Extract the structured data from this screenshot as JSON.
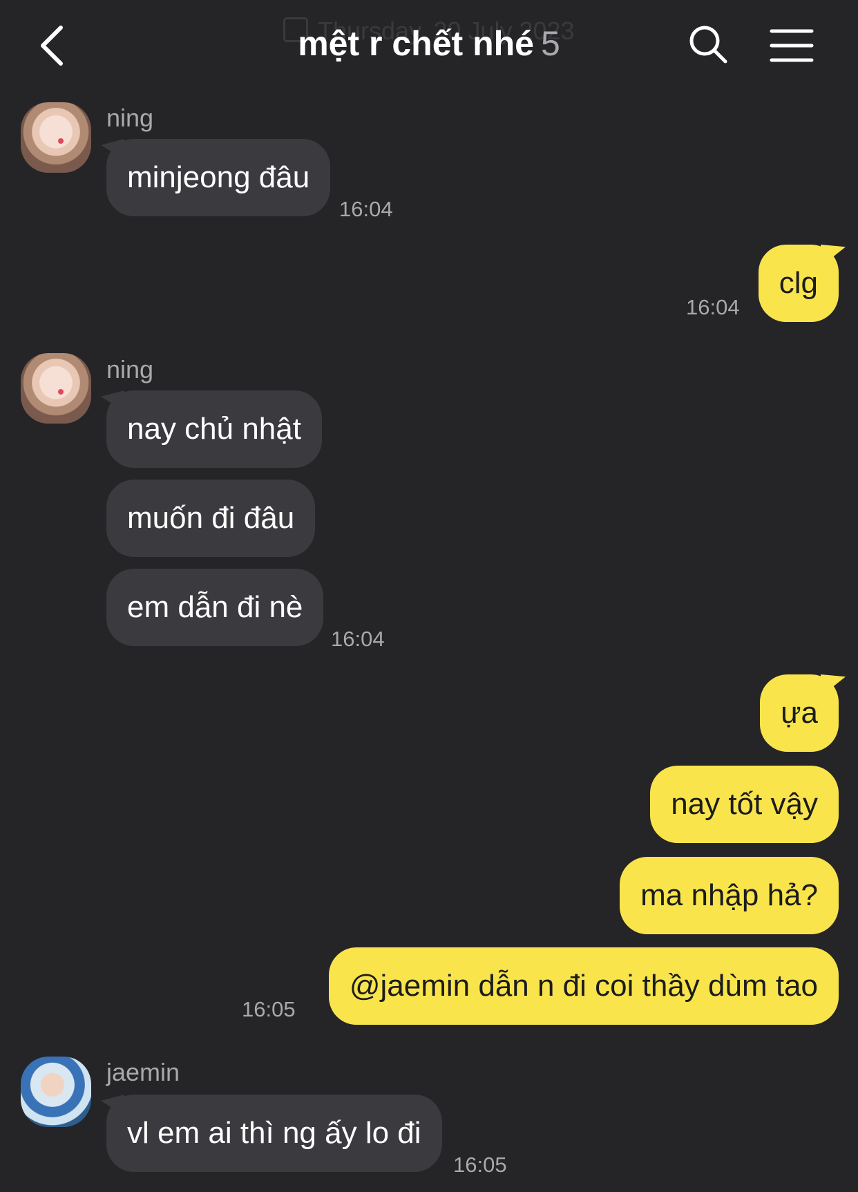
{
  "header": {
    "title": "mệt r chết nhé",
    "member_count": "5",
    "date_ghost": "Thursday, 20 July 2023",
    "back_icon": "chevron-left-icon",
    "search_icon": "search-icon",
    "menu_icon": "hamburger-menu-icon"
  },
  "colors": {
    "background": "#252527",
    "incoming_bubble": "#3b3b3f",
    "outgoing_bubble": "#f9e54b",
    "secondary_text": "#a9a9ad"
  },
  "messages": [
    {
      "sender": "ning",
      "text": "minjeong đâu",
      "time": "16:04",
      "direction": "in"
    },
    {
      "text": "clg",
      "time": "16:04",
      "direction": "out"
    },
    {
      "sender": "ning",
      "text": "nay chủ nhật",
      "direction": "in"
    },
    {
      "text": "muốn đi đâu",
      "direction": "in"
    },
    {
      "text": "em dẫn đi nè",
      "time": "16:04",
      "direction": "in"
    },
    {
      "text": "ựa",
      "direction": "out"
    },
    {
      "text": "nay tốt vậy",
      "direction": "out"
    },
    {
      "text": "ma nhập hả?",
      "direction": "out"
    },
    {
      "text": "@jaemin dẫn n đi coi thầy dùm tao",
      "time": "16:05",
      "direction": "out"
    },
    {
      "sender": "jaemin",
      "text": "vl em ai thì ng ấy lo đi",
      "time": "16:05",
      "direction": "in"
    }
  ]
}
